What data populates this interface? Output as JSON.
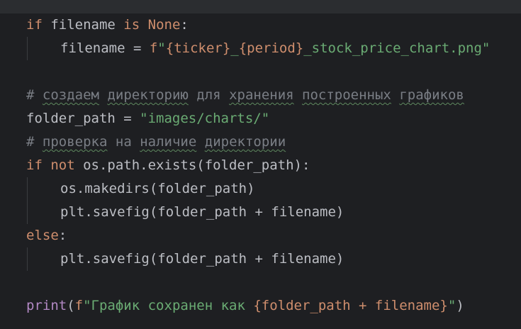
{
  "code": {
    "line1": {
      "kw_if": "if",
      "t1": " filename ",
      "kw_is": "is",
      "t2": " ",
      "kw_none": "None",
      "t3": ":"
    },
    "line2": {
      "t1": "filename = ",
      "fpre": "f",
      "s1": "\"",
      "b1": "{ticker}",
      "s2": "_",
      "b2": "{period}",
      "s3": "_stock_price_chart.png\""
    },
    "line4": {
      "hash": "#",
      "w1": "создаем",
      "w2": "директорию",
      "w3": "для",
      "w4": "хранения",
      "w5": "построенных",
      "w6": "графиков"
    },
    "line5": {
      "t1": "folder_path = ",
      "s1": "\"images/charts/\""
    },
    "line6": {
      "hash": "#",
      "w1": "проверка",
      "w2": "на",
      "w3": "наличие",
      "w4": "директории"
    },
    "line7": {
      "kw_if": "if",
      "t1": " ",
      "kw_not": "not",
      "t2": " os.path.exists(folder_path):"
    },
    "line8": {
      "t1": "os.makedirs(folder_path)"
    },
    "line9": {
      "t1": "plt.savefig(folder_path + filename)"
    },
    "line10": {
      "kw_else": "else",
      "t1": ":"
    },
    "line11": {
      "t1": "plt.savefig(folder_path + filename)"
    },
    "line13": {
      "fn_print": "print",
      "t1": "(",
      "fpre": "f",
      "s1": "\"График сохранен как ",
      "b1": "{folder_path + filename}",
      "s2": "\"",
      "t2": ")"
    }
  }
}
